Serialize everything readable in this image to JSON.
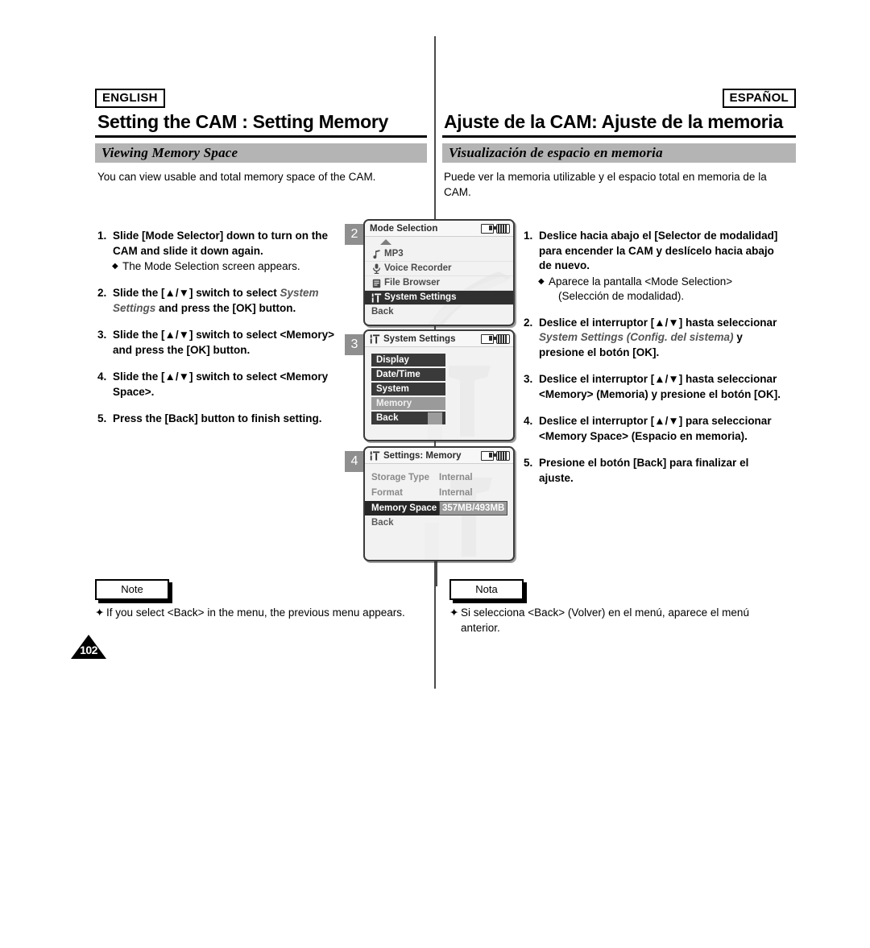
{
  "divider": {},
  "english": {
    "lang_tag": "ENGLISH",
    "title": "Setting the CAM : Setting Memory",
    "section_heading": "Viewing Memory Space",
    "intro": "You can view usable and total memory space of the CAM.",
    "steps": [
      {
        "num": "1.",
        "text_a": "Slide [Mode Selector] down to turn on the CAM and slide it down again.",
        "sub": "The Mode Selection screen appears."
      },
      {
        "num": "2.",
        "text_a": "Slide the [▲/▼] switch to select ",
        "italic": "System Settings",
        "text_b": " and press the [OK] button."
      },
      {
        "num": "3.",
        "text_a": "Slide the [▲/▼] switch to select <Memory> and press the [OK] button."
      },
      {
        "num": "4.",
        "text_a": "Slide the [▲/▼] switch to select <Memory Space>."
      },
      {
        "num": "5.",
        "text_a": "Press the [Back] button to finish setting."
      }
    ],
    "note_label": "Note",
    "note_text": "If you select <Back> in the menu, the previous menu appears."
  },
  "spanish": {
    "lang_tag": "ESPAÑOL",
    "title": "Ajuste de la CAM: Ajuste de la memoria",
    "section_heading": "Visualización de espacio en memoria",
    "intro": "Puede ver la memoria utilizable y el espacio total en memoria de la CAM.",
    "steps": [
      {
        "num": "1.",
        "text_a": "Deslice hacia abajo el [Selector de modalidad] para encender la CAM y deslícelo hacia abajo de nuevo.",
        "sub": "Aparece la pantalla <Mode Selection>",
        "sub_cont": "(Selección de modalidad)."
      },
      {
        "num": "2.",
        "text_a": "Deslice el interruptor [▲/▼] hasta seleccionar ",
        "italic": "System Settings (Config. del sistema)",
        "text_b": " y presione el botón [OK]."
      },
      {
        "num": "3.",
        "text_a": "Deslice el interruptor [▲/▼] hasta seleccionar <Memory> (Memoria) y presione el botón [OK]."
      },
      {
        "num": "4.",
        "text_a": "Deslice el interruptor [▲/▼] para seleccionar <Memory Space> (Espacio en memoria)."
      },
      {
        "num": "5.",
        "text_a": "Presione el botón [Back] para finalizar el ajuste."
      }
    ],
    "note_label": "Nota",
    "note_text": "Si selecciona <Back> (Volver) en el menú, aparece el menú anterior."
  },
  "screens": [
    {
      "badge": "2",
      "title": "Mode Selection",
      "type": "menu",
      "items": [
        {
          "label": "MP3",
          "icon": "music-note-icon",
          "selected": false
        },
        {
          "label": "Voice Recorder",
          "icon": "microphone-icon",
          "selected": false
        },
        {
          "label": "File Browser",
          "icon": "document-icon",
          "selected": false
        },
        {
          "label": "System Settings",
          "icon": "system-settings-icon",
          "selected": true
        },
        {
          "label": "Back",
          "icon": "none",
          "selected": false
        }
      ]
    },
    {
      "badge": "3",
      "title": "System Settings",
      "title_icon": "system-settings-icon",
      "type": "list",
      "items": [
        {
          "label": "Display",
          "highlighted": false
        },
        {
          "label": "Date/Time",
          "highlighted": false
        },
        {
          "label": "System",
          "highlighted": false
        },
        {
          "label": "Memory",
          "highlighted": true
        },
        {
          "label": "Back",
          "highlighted": false
        }
      ]
    },
    {
      "badge": "4",
      "title": "Settings: Memory",
      "title_icon": "system-settings-icon",
      "type": "table",
      "rows": [
        {
          "key": "Storage Type",
          "value": "Internal",
          "selected": false
        },
        {
          "key": "Format",
          "value": "Internal",
          "selected": false
        },
        {
          "key": "Memory Space",
          "value": "357MB/493MB",
          "selected": true
        }
      ],
      "back_label": "Back"
    }
  ],
  "page_number": "102",
  "colors": {
    "section_bar": "#b4b4b4",
    "badge": "#8f8f8f",
    "lcd_bg": "#f2f2f2",
    "selected_dark": "#303030",
    "highlight_gray": "#9a9a9a"
  }
}
